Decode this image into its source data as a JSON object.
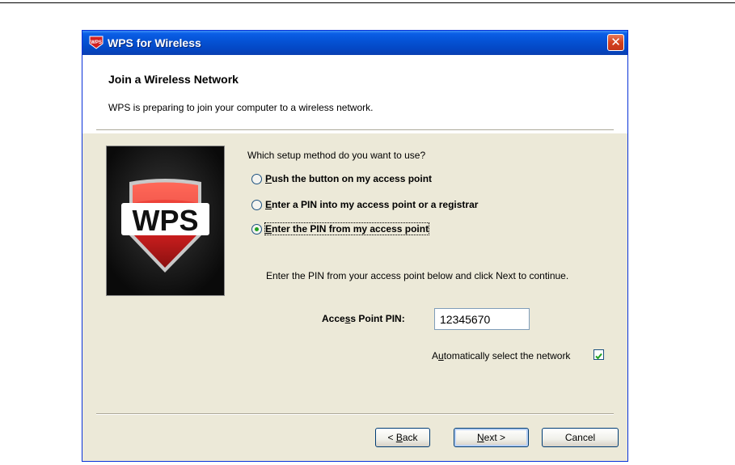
{
  "window": {
    "title": "WPS for Wireless",
    "close_symbol": "✕"
  },
  "header": {
    "title": "Join a Wireless Network",
    "subtitle": "WPS is preparing to join your computer to a wireless network."
  },
  "image": {
    "logo_text": "WPS",
    "icon": "wps-shield-logo"
  },
  "setup": {
    "question": "Which setup method do you want to use?",
    "options": [
      {
        "accel": "P",
        "rest": "ush the button on my access point",
        "selected": false
      },
      {
        "accel": "E",
        "rest": "nter a PIN into my access point or a registrar",
        "selected": false
      },
      {
        "accel": "E",
        "rest": "nter the PIN from my access point",
        "selected": true
      }
    ],
    "instruction": "Enter the PIN from your access point below and click Next to continue."
  },
  "pin": {
    "label_pre": "Acce",
    "label_accel": "s",
    "label_post": "s Point PIN:",
    "value": "12345670"
  },
  "auto_select": {
    "label_pre": "A",
    "label_accel": "u",
    "label_post": "tomatically select the network",
    "checked": true
  },
  "buttons": {
    "back_pre": "< ",
    "back_accel": "B",
    "back_post": "ack",
    "next_accel": "N",
    "next_post": "ext >",
    "cancel": "Cancel"
  },
  "colors": {
    "titlebar": "#0553d6",
    "dialog_bg": "#ece9d8",
    "radio_dot": "#21a121",
    "shield_red": "#d42020"
  }
}
